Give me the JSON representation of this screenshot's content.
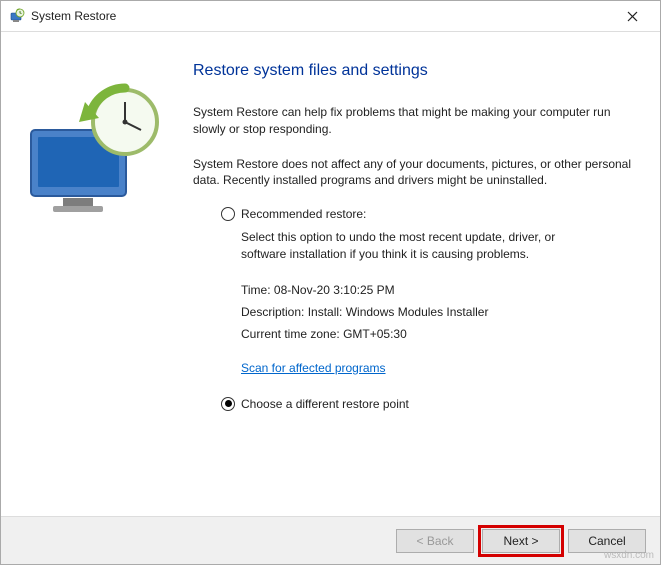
{
  "window": {
    "title": "System Restore"
  },
  "main": {
    "heading": "Restore system files and settings",
    "intro1": "System Restore can help fix problems that might be making your computer run slowly or stop responding.",
    "intro2": "System Restore does not affect any of your documents, pictures, or other personal data. Recently installed programs and drivers might be uninstalled.",
    "option_recommended": {
      "label": "Recommended restore:",
      "desc": "Select this option to undo the most recent update, driver, or software installation if you think it is causing problems.",
      "details": {
        "time_label": "Time:",
        "time_value": "08-Nov-20 3:10:25 PM",
        "desc_label": "Description:",
        "desc_value": "Install: Windows Modules Installer",
        "tz_label": "Current time zone:",
        "tz_value": "GMT+05:30"
      },
      "scan_link": "Scan for affected programs"
    },
    "option_different": {
      "label": "Choose a different restore point"
    }
  },
  "buttons": {
    "back": "< Back",
    "next": "Next >",
    "cancel": "Cancel"
  },
  "watermark": "wsxdn.com"
}
